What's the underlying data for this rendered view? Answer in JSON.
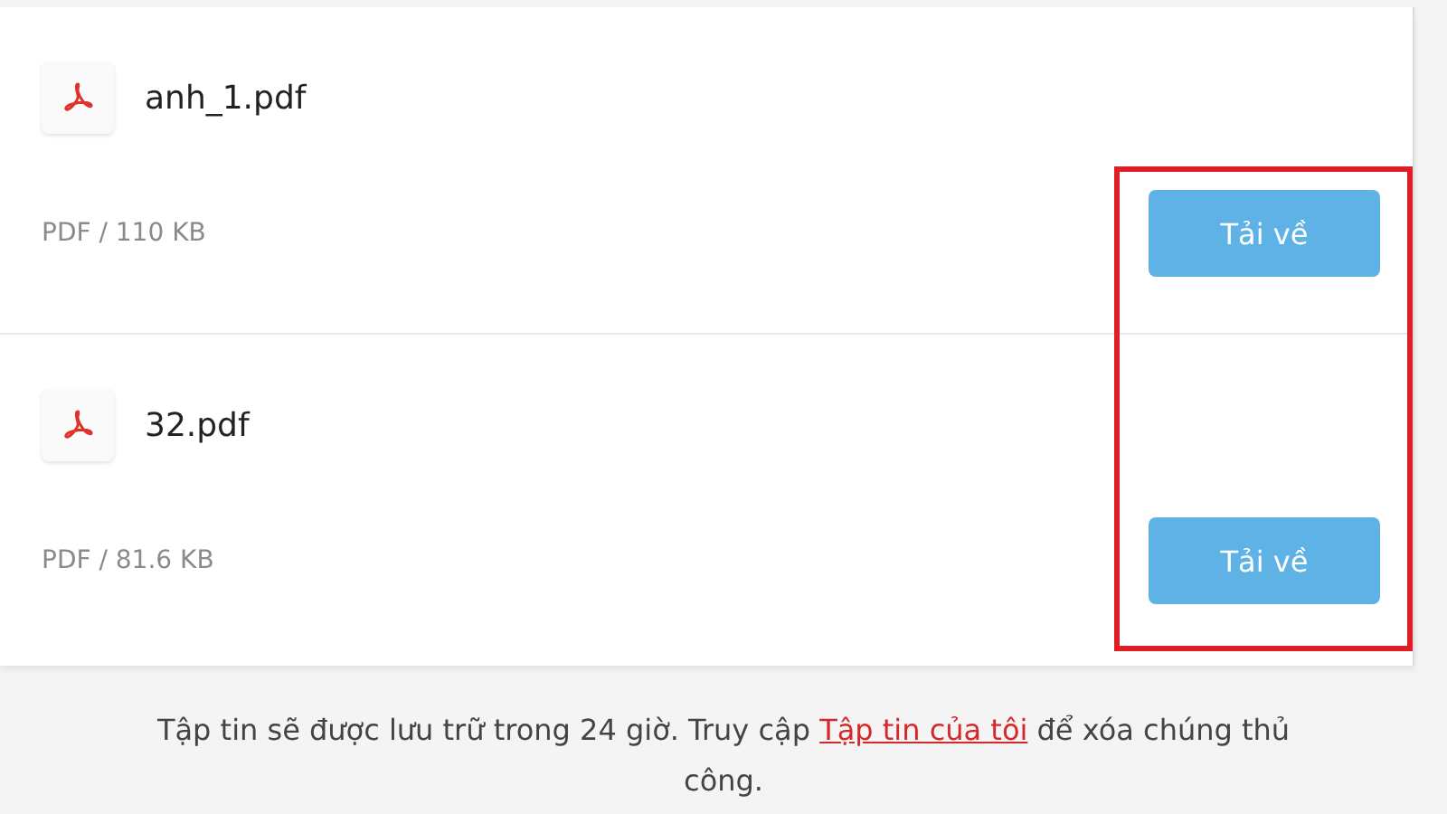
{
  "files": [
    {
      "name": "anh_1.pdf",
      "meta": "PDF / 110 KB",
      "button": "Tải về"
    },
    {
      "name": "32.pdf",
      "meta": "PDF / 81.6 KB",
      "button": "Tải về"
    }
  ],
  "notice": {
    "before": "Tập tin sẽ được lưu trữ trong 24 giờ. Truy cập ",
    "link": "Tập tin của tôi",
    "after": " để xóa chúng thủ công."
  }
}
